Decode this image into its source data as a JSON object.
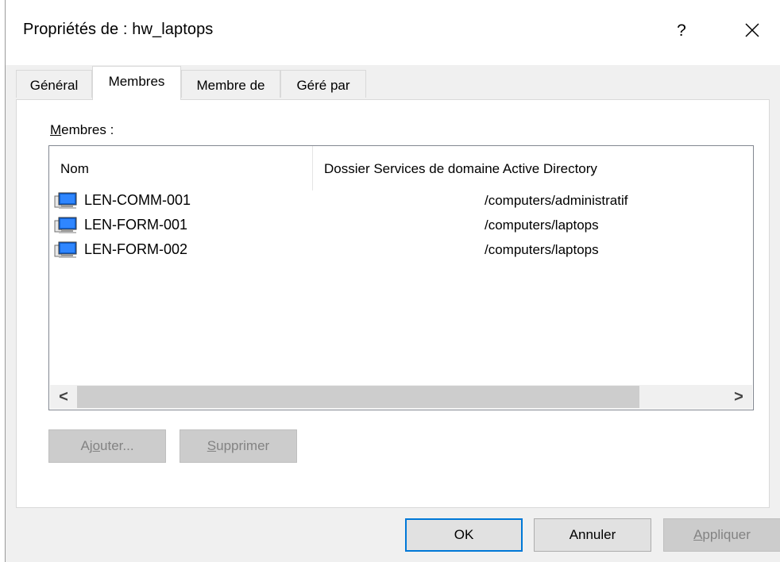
{
  "window": {
    "title": "Propriétés de : hw_laptops",
    "help_label": "?",
    "close_icon": "close-icon"
  },
  "tabs": [
    {
      "label": "Général",
      "active": false
    },
    {
      "label": "Membres",
      "active": true
    },
    {
      "label": "Membre de",
      "active": false
    },
    {
      "label": "Géré par",
      "active": false
    }
  ],
  "members": {
    "label_mnemonic": "M",
    "label_rest": "embres :",
    "columns": {
      "name": "Nom",
      "folder": "Dossier Services de domaine Active Directory"
    },
    "rows": [
      {
        "name": "LEN-COMM-001",
        "folder": "/computers/administratif",
        "icon": "computer-icon"
      },
      {
        "name": "LEN-FORM-001",
        "folder": "/computers/laptops",
        "icon": "computer-icon"
      },
      {
        "name": "LEN-FORM-002",
        "folder": "/computers/laptops",
        "icon": "computer-icon"
      }
    ],
    "scroll_left": "<",
    "scroll_right": ">"
  },
  "buttons": {
    "add": {
      "pre": "Aj",
      "mn": "o",
      "post": "uter..."
    },
    "remove": {
      "pre": "",
      "mn": "S",
      "post": "upprimer"
    },
    "ok": "OK",
    "cancel": "Annuler",
    "apply": {
      "pre": "",
      "mn": "A",
      "post": "ppliquer"
    }
  },
  "colors": {
    "accent": "#0078d7",
    "dialog_bg": "#f0f0f0",
    "disabled_text": "#838383"
  }
}
